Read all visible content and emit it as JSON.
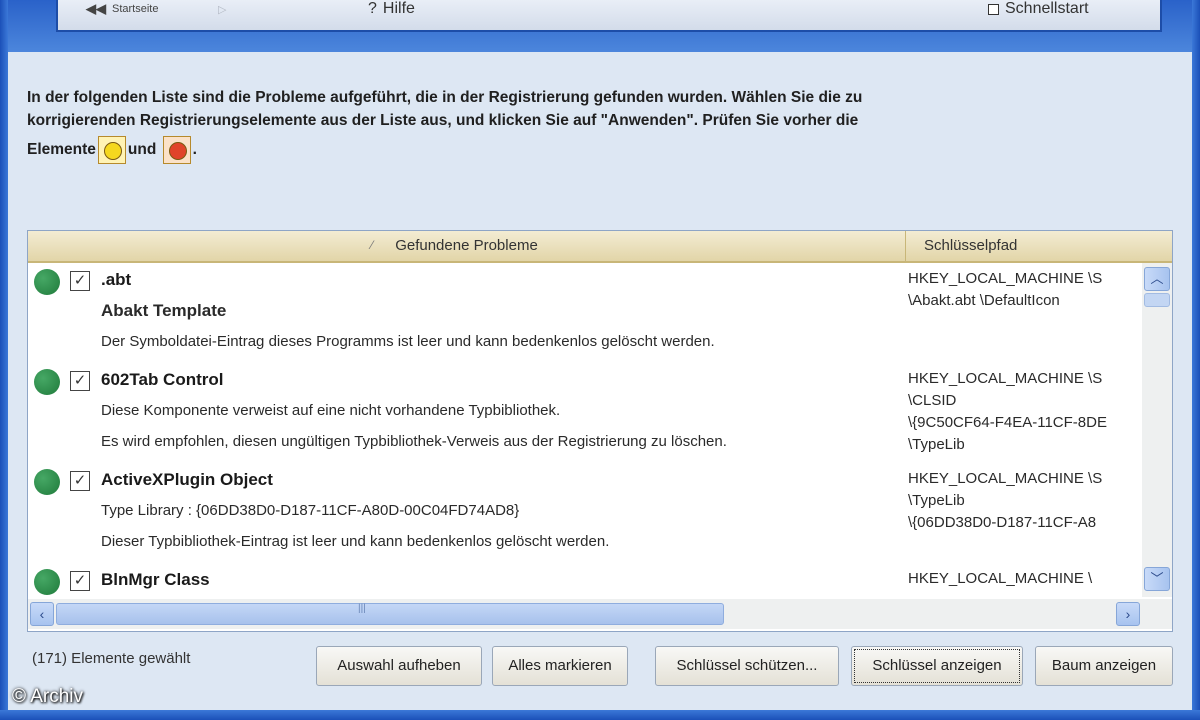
{
  "toolbar": {
    "back_label": "Startseite",
    "forward_label": "",
    "help_label": "Hilfe",
    "quickstart_label": "Schnellstart"
  },
  "intro": {
    "line1": "In der folgenden Liste sind die Probleme aufgeführt, die in der Registrierung gefunden wurden.  Wählen Sie die zu",
    "line2": "korrigierenden Registrierungselemente aus der Liste aus, und klicken Sie auf \"Anwenden\".  Prüfen Sie vorher die",
    "line3_pre": "Elemente",
    "line3_mid": "und",
    "line3_post": "."
  },
  "list": {
    "col_problems": "Gefundene Probleme",
    "col_path": "Schlüsselpfad",
    "rows": [
      {
        "title": ".abt",
        "lines": [
          "Abakt Template",
          "Der Symboldatei-Eintrag dieses Programms ist leer und kann bedenkenlos gelöscht werden."
        ],
        "path": [
          "HKEY_LOCAL_MACHINE \\S",
          "\\Abakt.abt \\DefaultIcon"
        ],
        "checked": true
      },
      {
        "title": "602Tab Control",
        "lines": [
          "Diese Komponente verweist auf eine nicht vorhandene Typbibliothek.",
          "Es wird empfohlen, diesen ungültigen Typbibliothek-Verweis aus der Registrierung zu löschen."
        ],
        "path": [
          "HKEY_LOCAL_MACHINE \\S",
          "\\CLSID",
          "\\{9C50CF64-F4EA-11CF-8DE",
          "\\TypeLib"
        ],
        "checked": true
      },
      {
        "title": "ActiveXPlugin Object",
        "lines": [
          "Type Library : {06DD38D0-D187-11CF-A80D-00C04FD74AD8}",
          "Dieser Typbibliothek-Eintrag ist leer und kann bedenkenlos gelöscht werden."
        ],
        "path": [
          "HKEY_LOCAL_MACHINE \\S",
          "\\TypeLib",
          "\\{06DD38D0-D187-11CF-A8"
        ],
        "checked": true
      },
      {
        "title": "BlnMgr Class",
        "lines": [],
        "path": [
          "HKEY_LOCAL_MACHINE \\"
        ],
        "checked": true
      }
    ]
  },
  "footer": {
    "status": "(171) Elemente gewählt",
    "buttons": [
      "Auswahl aufheben",
      "Alles markieren",
      "Schlüssel schützen...",
      "Schlüssel anzeigen",
      "Baum anzeigen"
    ]
  },
  "watermark": "© Archiv",
  "colors": {
    "frame_blue": "#1b50b8",
    "severity_green": "#1f7a3b",
    "warning_yellow": "#f5d81e",
    "error_red": "#e0442a"
  },
  "icons": {
    "severity": "green-status-dot-icon",
    "checkbox": "checkmark-icon",
    "sort": "sort-arrow-icon"
  }
}
